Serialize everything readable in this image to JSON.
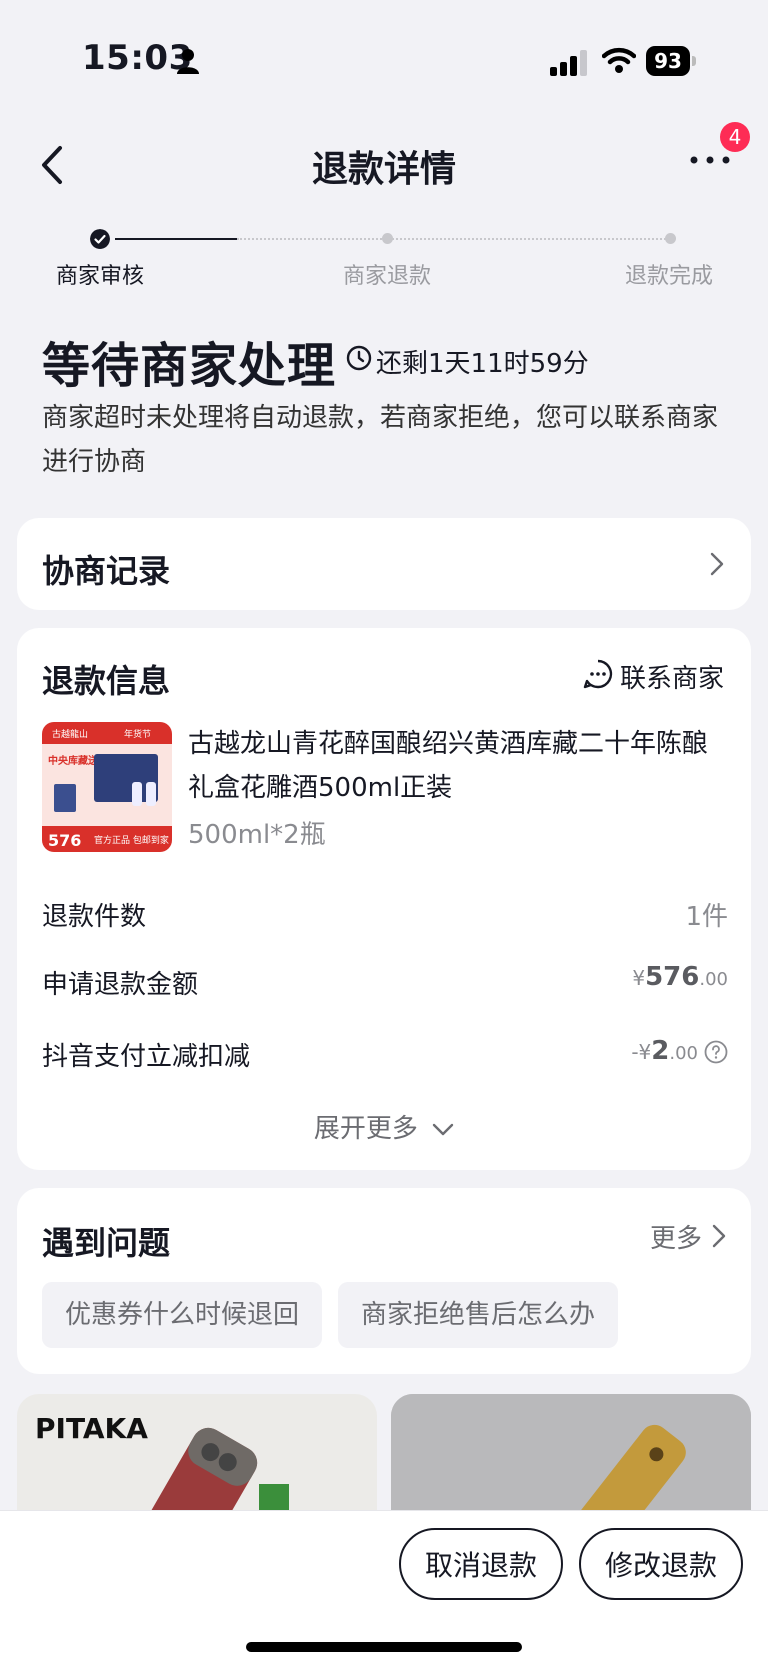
{
  "status_bar": {
    "time": "15:03",
    "battery": "93"
  },
  "nav": {
    "title": "退款详情",
    "badge_count": "4"
  },
  "progress": {
    "steps": [
      {
        "label": "商家审核",
        "state": "done"
      },
      {
        "label": "商家退款",
        "state": "pending"
      },
      {
        "label": "退款完成",
        "state": "pending"
      }
    ]
  },
  "status": {
    "title": "等待商家处理",
    "countdown": "还剩1天11时59分",
    "description": "商家超时未处理将自动退款，若商家拒绝，您可以联系商家进行协商"
  },
  "negotiation": {
    "label": "协商记录"
  },
  "refund_info": {
    "title": "退款信息",
    "contact_label": "联系商家",
    "product": {
      "name": "古越龙山青花醉国酿绍兴黄酒库藏二十年陈酿礼盒花雕酒500ml正装",
      "spec": "500ml*2瓶",
      "thumb_texts": {
        "brand": "古越龍山",
        "event": "年货节",
        "headline": "中央库藏送礼佳品",
        "price": "576",
        "footer": "官方正品 包邮到家"
      }
    },
    "rows": [
      {
        "label": "退款件数",
        "value": "1件"
      },
      {
        "label": "申请退款金额",
        "currency": "¥",
        "int": "576",
        "dec": ".00"
      },
      {
        "label": "抖音支付立减扣减",
        "currency": "-¥",
        "int": "2",
        "dec": ".00"
      }
    ],
    "expand_label": "展开更多"
  },
  "faq": {
    "title": "遇到问题",
    "more_label": "更多",
    "chips": [
      "优惠券什么时候退回",
      "商家拒绝售后怎么办"
    ]
  },
  "promos": [
    {
      "brand": "PITAKA"
    },
    {
      "brand": ""
    }
  ],
  "actions": {
    "cancel_label": "取消退款",
    "modify_label": "修改退款"
  }
}
